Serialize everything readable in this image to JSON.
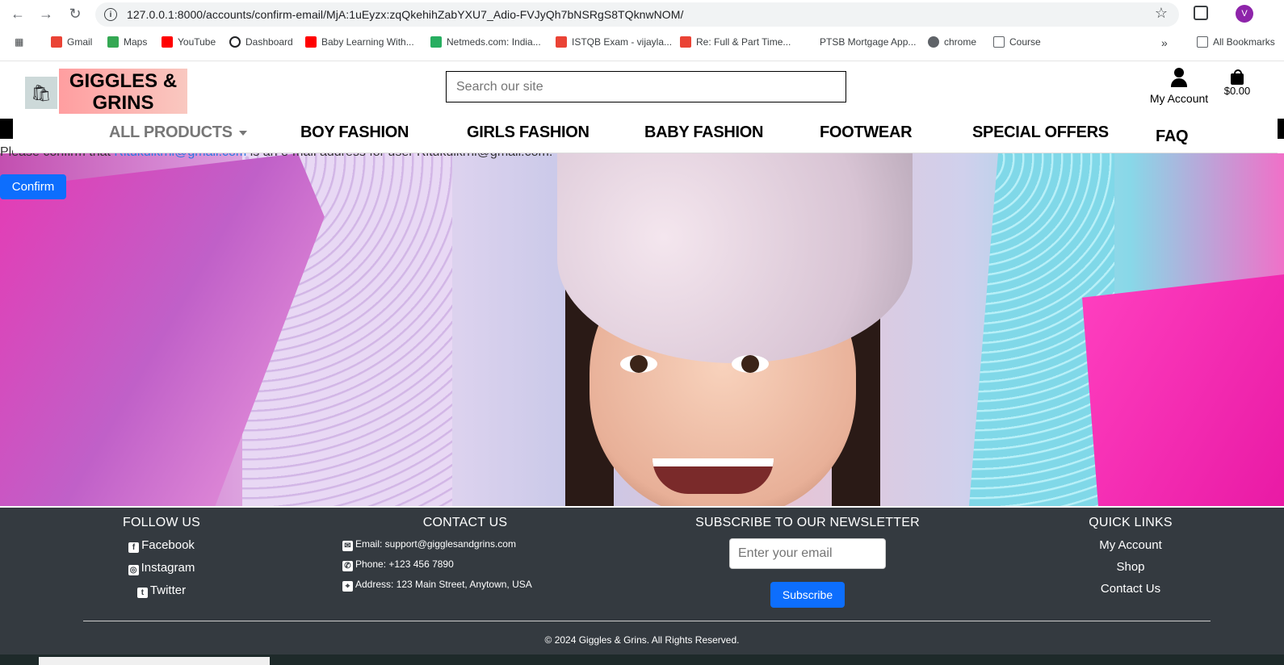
{
  "browser": {
    "url": "127.0.0.1:8000/accounts/confirm-email/MjA:1uEyzx:zqQkehihZabYXU7_Adio-FVJyQh7bNSRgS8TQknwNOM/",
    "profile_initial": "V",
    "bookmarks": [
      {
        "label": "Gmail",
        "icon": "gmail-icon",
        "color": "#ea4335"
      },
      {
        "label": "Maps",
        "icon": "maps-icon",
        "color": "#34a853"
      },
      {
        "label": "YouTube",
        "icon": "youtube-icon",
        "color": "#ff0000"
      },
      {
        "label": "Dashboard",
        "icon": "dashboard-icon",
        "color": "#202124"
      },
      {
        "label": "Baby Learning With...",
        "icon": "youtube-icon",
        "color": "#ff0000"
      },
      {
        "label": "Netmeds.com: India...",
        "icon": "netmeds-icon",
        "color": "#27ae60"
      },
      {
        "label": "ISTQB Exam - vijayla...",
        "icon": "gmail-icon",
        "color": "#ea4335"
      },
      {
        "label": "Re: Full & Part Time...",
        "icon": "gmail-icon",
        "color": "#ea4335"
      },
      {
        "label": "PTSB Mortgage App...",
        "icon": "blank-icon",
        "color": "#ffffff"
      },
      {
        "label": "chrome",
        "icon": "globe-icon",
        "color": "#5f6368"
      },
      {
        "label": "Course",
        "icon": "folder-icon",
        "color": "#5f6368"
      }
    ],
    "all_bookmarks": "All Bookmarks"
  },
  "header": {
    "logo_text": "GIGGLES & GRINS",
    "search_placeholder": "Search our site",
    "account_label": "My Account",
    "cart_total": "$0.00"
  },
  "nav": {
    "items": [
      "ALL PRODUCTS",
      "BOY FASHION",
      "GIRLS FASHION",
      "BABY FASHION",
      "FOOTWEAR",
      "SPECIAL OFFERS",
      "FAQ"
    ]
  },
  "confirm": {
    "text_before": "Please confirm that ",
    "email_link": "Ritukulkrni@gmail.com",
    "text_after": " is an e-mail address for user Ritukulkrni@gmail.com.",
    "button_label": "Confirm"
  },
  "footer": {
    "follow": {
      "title": "FOLLOW US",
      "links": [
        "Facebook",
        "Instagram",
        "Twitter"
      ]
    },
    "contact": {
      "title": "CONTACT US",
      "email": "Email: support@gigglesandgrins.com",
      "phone": "Phone: +123 456 7890",
      "address": "Address: 123 Main Street, Anytown, USA"
    },
    "newsletter": {
      "title": "SUBSCRIBE TO OUR NEWSLETTER",
      "placeholder": "Enter your email",
      "button": "Subscribe"
    },
    "quick_links": {
      "title": "QUICK LINKS",
      "links": [
        "My Account",
        "Shop",
        "Contact Us"
      ]
    },
    "copyright": "© 2024 Giggles & Grins. All Rights Reserved."
  }
}
